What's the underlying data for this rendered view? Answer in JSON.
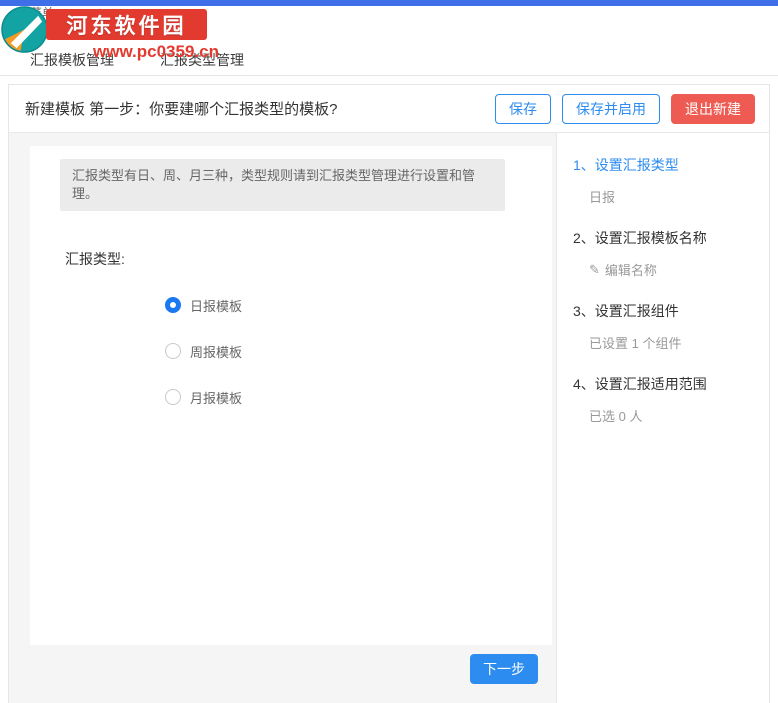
{
  "watermark": {
    "site_name": "河东软件园",
    "site_url": "www.pc0359.cn"
  },
  "top_menu_label": "菜单",
  "tabs": [
    {
      "label": "汇报模板管理"
    },
    {
      "label": "汇报类型管理"
    }
  ],
  "panel": {
    "title": "新建模板 第一步：你要建哪个汇报类型的模板?",
    "buttons": {
      "save": "保存",
      "save_and_enable": "保存并启用",
      "exit": "退出新建"
    },
    "notice": "汇报类型有日、周、月三种，类型规则请到汇报类型管理进行设置和管理。",
    "type_label": "汇报类型:",
    "options": [
      {
        "label": "日报模板",
        "selected": true
      },
      {
        "label": "周报模板",
        "selected": false
      },
      {
        "label": "月报模板",
        "selected": false
      }
    ],
    "next_button": "下一步"
  },
  "steps": [
    {
      "title": "1、设置汇报类型",
      "detail": "日报",
      "active": true
    },
    {
      "title": "2、设置汇报模板名称",
      "detail": "编辑名称",
      "active": false,
      "icon": "pencil-icon"
    },
    {
      "title": "3、设置汇报组件",
      "detail": "已设置 1 个组件",
      "active": false
    },
    {
      "title": "4、设置汇报适用范围",
      "detail": "已选 0 人",
      "active": false
    }
  ],
  "colors": {
    "accent_blue": "#2d8cf0",
    "danger_red": "#ed5b52",
    "watermark_red": "#e23a2e",
    "topbar_blue": "#3e6fe8"
  }
}
